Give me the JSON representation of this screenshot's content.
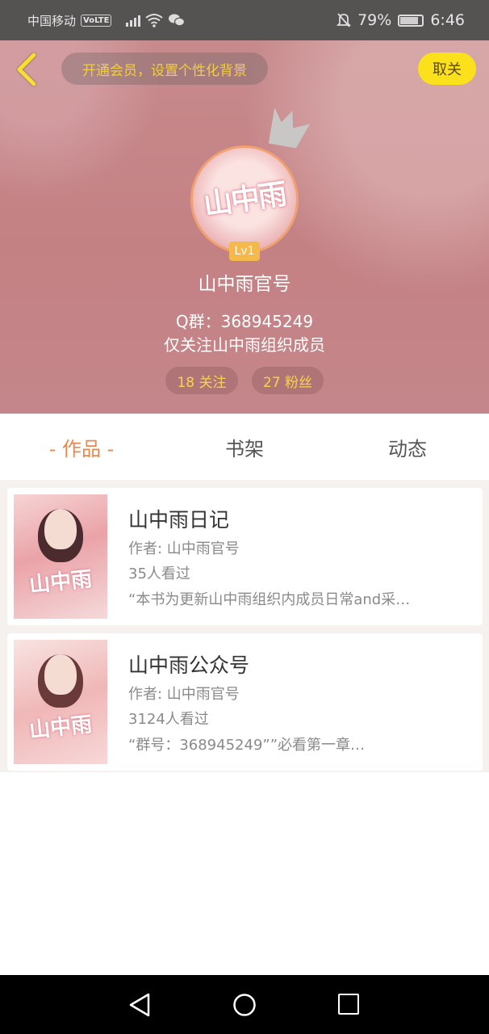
{
  "status_bar": {
    "carrier": "中国移动",
    "volte": "VoLTE",
    "battery_percent": "79%",
    "time": "6:46"
  },
  "header": {
    "background_tip": "开通会员，设置个性化背景",
    "unfollow_label": "取关",
    "avatar_text": "山中雨",
    "level": "Lv1",
    "name": "山中雨官号",
    "bio_line1": "Q群：368945249",
    "bio_line2": "仅关注山中雨组织成员",
    "follow_count": "18 关注",
    "fans_count": "27 粉丝"
  },
  "tabs": [
    {
      "label": "- 作品 -",
      "active": true
    },
    {
      "label": "书架",
      "active": false
    },
    {
      "label": "动态",
      "active": false
    }
  ],
  "books": [
    {
      "title": "山中雨日记",
      "author": "作者: 山中雨官号",
      "views": "35人看过",
      "desc": "“本书为更新山中雨组织内成员日常and采…",
      "cover_text": "山中雨"
    },
    {
      "title": "山中雨公众号",
      "author": "作者: 山中雨官号",
      "views": "3124人看过",
      "desc": "“群号：368945249””必看第一章…",
      "cover_text": "山中雨"
    }
  ],
  "colors": {
    "accent_orange": "#e98a4c",
    "unfollow_yellow": "#fbe01c",
    "stat_text": "#f4d54a"
  }
}
